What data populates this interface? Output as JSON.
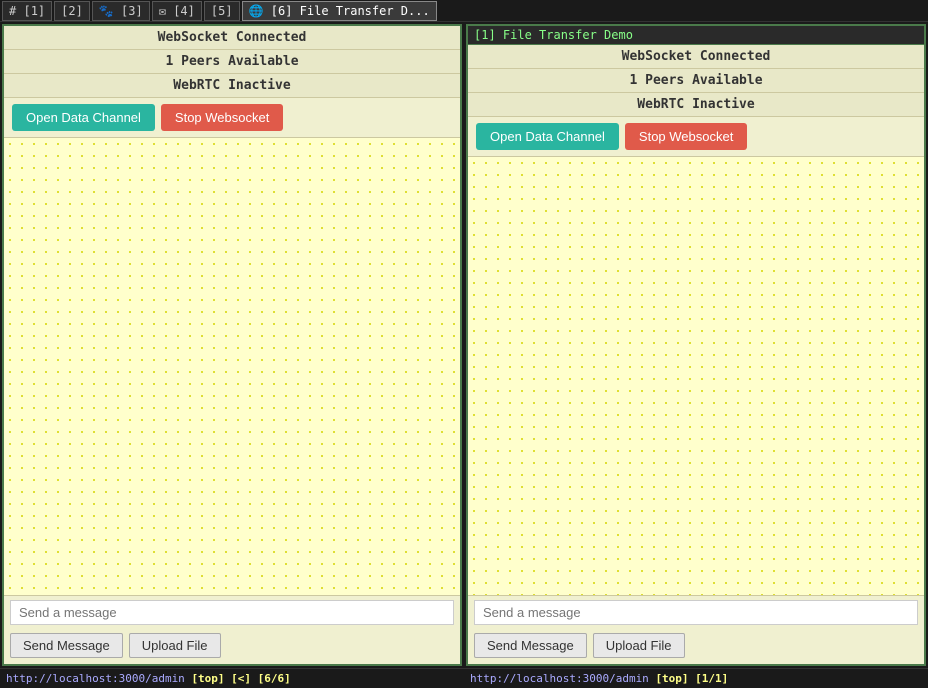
{
  "tabs": [
    {
      "id": 1,
      "label": "#",
      "num": "[1]",
      "icon": "",
      "active": false
    },
    {
      "id": 2,
      "label": "",
      "num": "[2]",
      "icon": "",
      "active": false
    },
    {
      "id": 3,
      "label": "🐾",
      "num": "[3]",
      "icon": "",
      "active": false
    },
    {
      "id": 4,
      "label": "✉",
      "num": "[4]",
      "icon": "",
      "active": false
    },
    {
      "id": 5,
      "label": "",
      "num": "[5]",
      "icon": "",
      "active": false
    },
    {
      "id": 6,
      "label": "🌐",
      "num": "[6] File Transfer D...",
      "icon": "",
      "active": true
    }
  ],
  "right_panel_title": "[1] File Transfer Demo",
  "panels": [
    {
      "id": "left",
      "title": "",
      "websocket_status": "WebSocket Connected",
      "peers_status": "1 Peers Available",
      "webrtc_status": "WebRTC Inactive",
      "open_channel_label": "Open Data Channel",
      "stop_websocket_label": "Stop Websocket",
      "message_placeholder": "Send a message",
      "send_message_label": "Send Message",
      "upload_file_label": "Upload File"
    },
    {
      "id": "right",
      "title": "[1] File Transfer Demo",
      "websocket_status": "WebSocket Connected",
      "peers_status": "1 Peers Available",
      "webrtc_status": "WebRTC Inactive",
      "open_channel_label": "Open Data Channel",
      "stop_websocket_label": "Stop Websocket",
      "message_placeholder": "Send a message",
      "send_message_label": "Send Message",
      "upload_file_label": "Upload File"
    }
  ],
  "status_bar": [
    {
      "url": "http://localhost:3000/admin",
      "info": "[top] [<] [6/6]"
    },
    {
      "url": "http://localhost:3000/admin",
      "info": "[top] [1/1]"
    }
  ]
}
